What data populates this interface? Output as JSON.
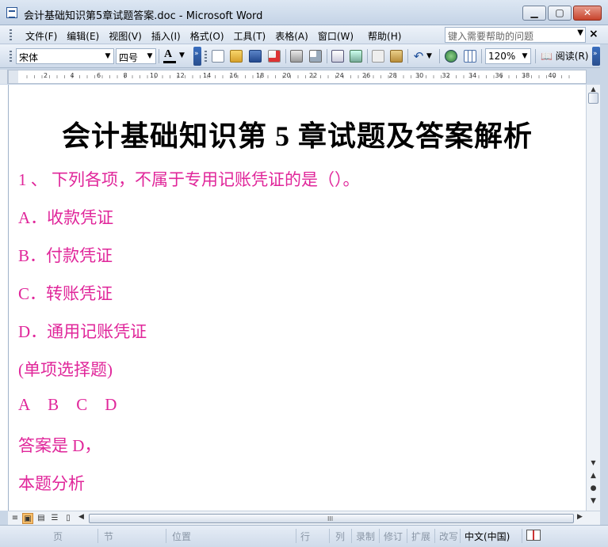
{
  "window": {
    "title": "会计基础知识第5章试题答案.doc - Microsoft Word",
    "minimize_glyph": "▁",
    "maximize_glyph": "▢",
    "close_glyph": "✕"
  },
  "menubar": {
    "items": [
      "文件(F)",
      "编辑(E)",
      "视图(V)",
      "插入(I)",
      "格式(O)",
      "工具(T)",
      "表格(A)",
      "窗口(W)",
      "帮助(H)"
    ],
    "help_placeholder": "键入需要帮助的问题",
    "close_glyph": "×"
  },
  "toolbar": {
    "font_name": "宋体",
    "font_size": "四号",
    "font_color_letter": "A",
    "zoom": "120%",
    "read_label": "阅读(R)",
    "icons": [
      "new-doc-icon",
      "open-icon",
      "save-icon",
      "permission-icon",
      "print-icon",
      "print-preview-icon",
      "spelling-icon",
      "research-icon",
      "copy-icon",
      "paste-icon",
      "undo-icon",
      "hyperlink-icon",
      "table-icon"
    ]
  },
  "ruler": {
    "labels": [
      "2",
      "4",
      "6",
      "8",
      "10",
      "12",
      "14",
      "16",
      "18",
      "20",
      "22",
      "24",
      "26",
      "28",
      "30",
      "32",
      "34",
      "36",
      "38",
      "40"
    ]
  },
  "document": {
    "title": "会计基础知识第 5 章试题及答案解析",
    "question": "1 、  下列各项，不属于专用记账凭证的是（）。",
    "option_a": "A．收款凭证",
    "option_b": "B．付款凭证",
    "option_c": "C．转账凭证",
    "option_d": "D．通用记账凭证",
    "type": "(单项选择题)",
    "choices": [
      "A",
      "B",
      "C",
      "D"
    ],
    "answer": "答案是 D，",
    "analysis": "本题分析",
    "text_color": "#e0269a"
  },
  "hscroll": {
    "grip": "III"
  },
  "statusbar": {
    "page": "页",
    "section": "节",
    "position": "位置",
    "line": "行",
    "column": "列",
    "rec": "录制",
    "trk": "修订",
    "ext": "扩展",
    "ovr": "改写",
    "language": "中文(中国)"
  }
}
